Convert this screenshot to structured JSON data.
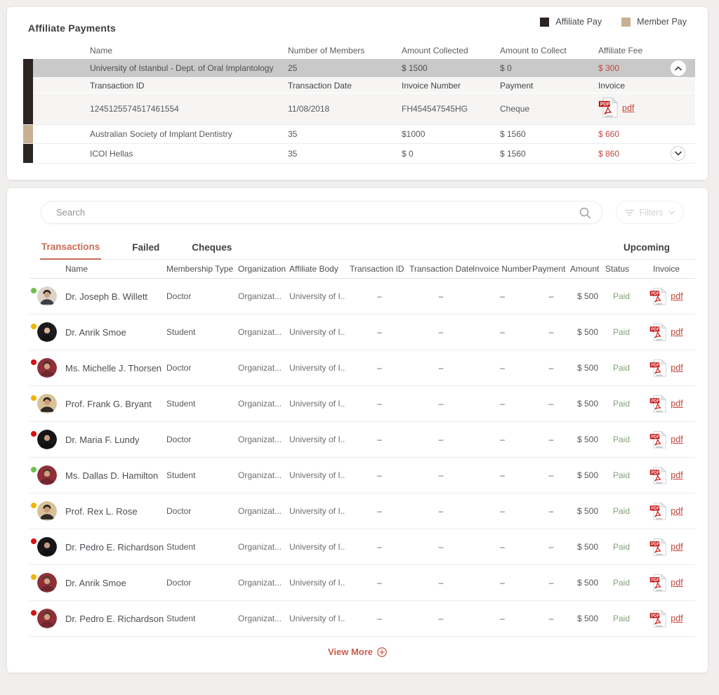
{
  "colors": {
    "affiliate_pay": "#2b2422",
    "member_pay": "#c9b094",
    "accent_red": "#bf4a40",
    "tab_active": "#ca6d59",
    "paid_green": "#83a178",
    "dot_green": "#6cc04a",
    "dot_yellow": "#f2b300",
    "dot_red": "#d50f0f"
  },
  "affiliate_payments": {
    "title": "Affiliate Payments",
    "legend": [
      {
        "label": "Affiliate Pay",
        "color": "#2b2422"
      },
      {
        "label": "Member Pay",
        "color": "#c9b094"
      }
    ],
    "columns": [
      "Name",
      "Number of Members",
      "Amount Collected",
      "Amount to Collect",
      "Affiliate Fee"
    ],
    "rows": [
      {
        "name": "University of Istanbul - Dept. of Oral Implantology",
        "members": "25",
        "collected": "$ 1500",
        "to_collect": "$ 0",
        "fee": "$ 300",
        "bar_color": "#2b2422",
        "expanded": true,
        "details": {
          "columns": [
            "Transaction ID",
            "Transaction Date",
            "Invoice Number",
            "Payment",
            "Invoice"
          ],
          "row": {
            "transaction_id": "1245125574517461554",
            "transaction_date": "11/08/2018",
            "invoice_number": "FH454547545HG",
            "payment": "Cheque",
            "invoice_label": "pdf"
          }
        }
      },
      {
        "name": "Australian Society of Implant Dentistry",
        "members": "35",
        "collected": "$1000",
        "to_collect": "$ 1560",
        "fee": "$ 660",
        "bar_color": "#c9b094",
        "expanded": false
      },
      {
        "name": "ICOI Hellas",
        "members": "35",
        "collected": "$ 0",
        "to_collect": "$ 1560",
        "fee": "$ 860",
        "bar_color": "#2b2422",
        "expanded": false
      }
    ]
  },
  "transactions_panel": {
    "search": {
      "placeholder": "Search"
    },
    "filters_label": "Filters",
    "tabs": [
      {
        "label": "Transactions",
        "active": true
      },
      {
        "label": "Failed",
        "active": false
      },
      {
        "label": "Cheques",
        "active": false
      }
    ],
    "right_tab": "Upcoming",
    "columns": [
      "Name",
      "Membership Type",
      "Organization",
      "Affiliate Body",
      "Transaction ID",
      "Transaction Date",
      "Invoice Number",
      "Payment",
      "Amount",
      "Status",
      "Invoice"
    ],
    "rows": [
      {
        "name": "Dr.  Joseph B. Willett",
        "membership_type": "Doctor",
        "organization": "Organizat...",
        "affiliate_body": "University of I..",
        "transaction_id": "–",
        "transaction_date": "–",
        "invoice_number": "–",
        "payment": "–",
        "amount": "$ 500",
        "status": "Paid",
        "invoice_label": "pdf",
        "dot": "#6cc04a",
        "avatar": {
          "bg": "#ddd3c8",
          "skin": "#caa287",
          "shirt": "#3a3f44",
          "hair": "#2a2320"
        }
      },
      {
        "name": "Dr.  Anrik Smoe",
        "membership_type": "Student",
        "organization": "Organizat...",
        "affiliate_body": "University of I..",
        "transaction_id": "–",
        "transaction_date": "–",
        "invoice_number": "–",
        "payment": "–",
        "amount": "$ 500",
        "status": "Paid",
        "invoice_label": "pdf",
        "dot": "#f2b300",
        "avatar": {
          "bg": "#1c1b20",
          "skin": "#d8b49a",
          "shirt": "#141318",
          "hair": "#201a18"
        }
      },
      {
        "name": "Ms. Michelle J. Thorsen",
        "membership_type": "Doctor",
        "organization": "Organizat...",
        "affiliate_body": "University of I..",
        "transaction_id": "–",
        "transaction_date": "–",
        "invoice_number": "–",
        "payment": "–",
        "amount": "$ 500",
        "status": "Paid",
        "invoice_label": "pdf",
        "dot": "#d50f0f",
        "avatar": {
          "bg": "#8e3038",
          "skin": "#d2a183",
          "shirt": "#70262e",
          "hair": "#4a2c22"
        }
      },
      {
        "name": "Prof. Frank G. Bryant",
        "membership_type": "Student",
        "organization": "Organizat...",
        "affiliate_body": "University of I..",
        "transaction_id": "–",
        "transaction_date": "–",
        "invoice_number": "–",
        "payment": "–",
        "amount": "$ 500",
        "status": "Paid",
        "invoice_label": "pdf",
        "dot": "#f2b300",
        "avatar": {
          "bg": "#d9c099",
          "skin": "#c99a76",
          "shirt": "#2e2a26",
          "hair": "#221d1a"
        }
      },
      {
        "name": "Dr.  Maria F. Lundy",
        "membership_type": "Doctor",
        "organization": "Organizat...",
        "affiliate_body": "University of I..",
        "transaction_id": "–",
        "transaction_date": "–",
        "invoice_number": "–",
        "payment": "–",
        "amount": "$ 500",
        "status": "Paid",
        "invoice_label": "pdf",
        "dot": "#d50f0f",
        "avatar": {
          "bg": "#17171a",
          "skin": "#c69a80",
          "shirt": "#101013",
          "hair": "#17120f"
        }
      },
      {
        "name": "Ms. Dallas D. Hamilton",
        "membership_type": "Student",
        "organization": "Organizat...",
        "affiliate_body": "University of I..",
        "transaction_id": "–",
        "transaction_date": "–",
        "invoice_number": "–",
        "payment": "–",
        "amount": "$ 500",
        "status": "Paid",
        "invoice_label": "pdf",
        "dot": "#6cc04a",
        "avatar": {
          "bg": "#8e3038",
          "skin": "#d2a183",
          "shirt": "#70262e",
          "hair": "#55392b"
        }
      },
      {
        "name": "Prof. Rex L. Rose",
        "membership_type": "Doctor",
        "organization": "Organizat...",
        "affiliate_body": "University of I..",
        "transaction_id": "–",
        "transaction_date": "–",
        "invoice_number": "–",
        "payment": "–",
        "amount": "$ 500",
        "status": "Paid",
        "invoice_label": "pdf",
        "dot": "#f2b300",
        "avatar": {
          "bg": "#d9c099",
          "skin": "#c99a76",
          "shirt": "#2e2a26",
          "hair": "#221d1a"
        }
      },
      {
        "name": "Dr.  Pedro E. Richardson",
        "membership_type": "Student",
        "organization": "Organizat...",
        "affiliate_body": "University of I..",
        "transaction_id": "–",
        "transaction_date": "–",
        "invoice_number": "–",
        "payment": "–",
        "amount": "$ 500",
        "status": "Paid",
        "invoice_label": "pdf",
        "dot": "#d50f0f",
        "avatar": {
          "bg": "#17171a",
          "skin": "#c69a80",
          "shirt": "#101013",
          "hair": "#17120f"
        }
      },
      {
        "name": "Dr.  Anrik Smoe",
        "membership_type": "Doctor",
        "organization": "Organizat...",
        "affiliate_body": "University of I..",
        "transaction_id": "–",
        "transaction_date": "–",
        "invoice_number": "–",
        "payment": "–",
        "amount": "$ 500",
        "status": "Paid",
        "invoice_label": "pdf",
        "dot": "#f2b300",
        "avatar": {
          "bg": "#8e3038",
          "skin": "#d2a183",
          "shirt": "#70262e",
          "hair": "#55392b"
        }
      },
      {
        "name": "Dr.  Pedro E. Richardson",
        "membership_type": "Student",
        "organization": "Organizat...",
        "affiliate_body": "University of I..",
        "transaction_id": "–",
        "transaction_date": "–",
        "invoice_number": "–",
        "payment": "–",
        "amount": "$ 500",
        "status": "Paid",
        "invoice_label": "pdf",
        "dot": "#d50f0f",
        "avatar": {
          "bg": "#8e3038",
          "skin": "#d2a183",
          "shirt": "#70262e",
          "hair": "#55392b"
        }
      }
    ],
    "view_more_label": "View More"
  }
}
